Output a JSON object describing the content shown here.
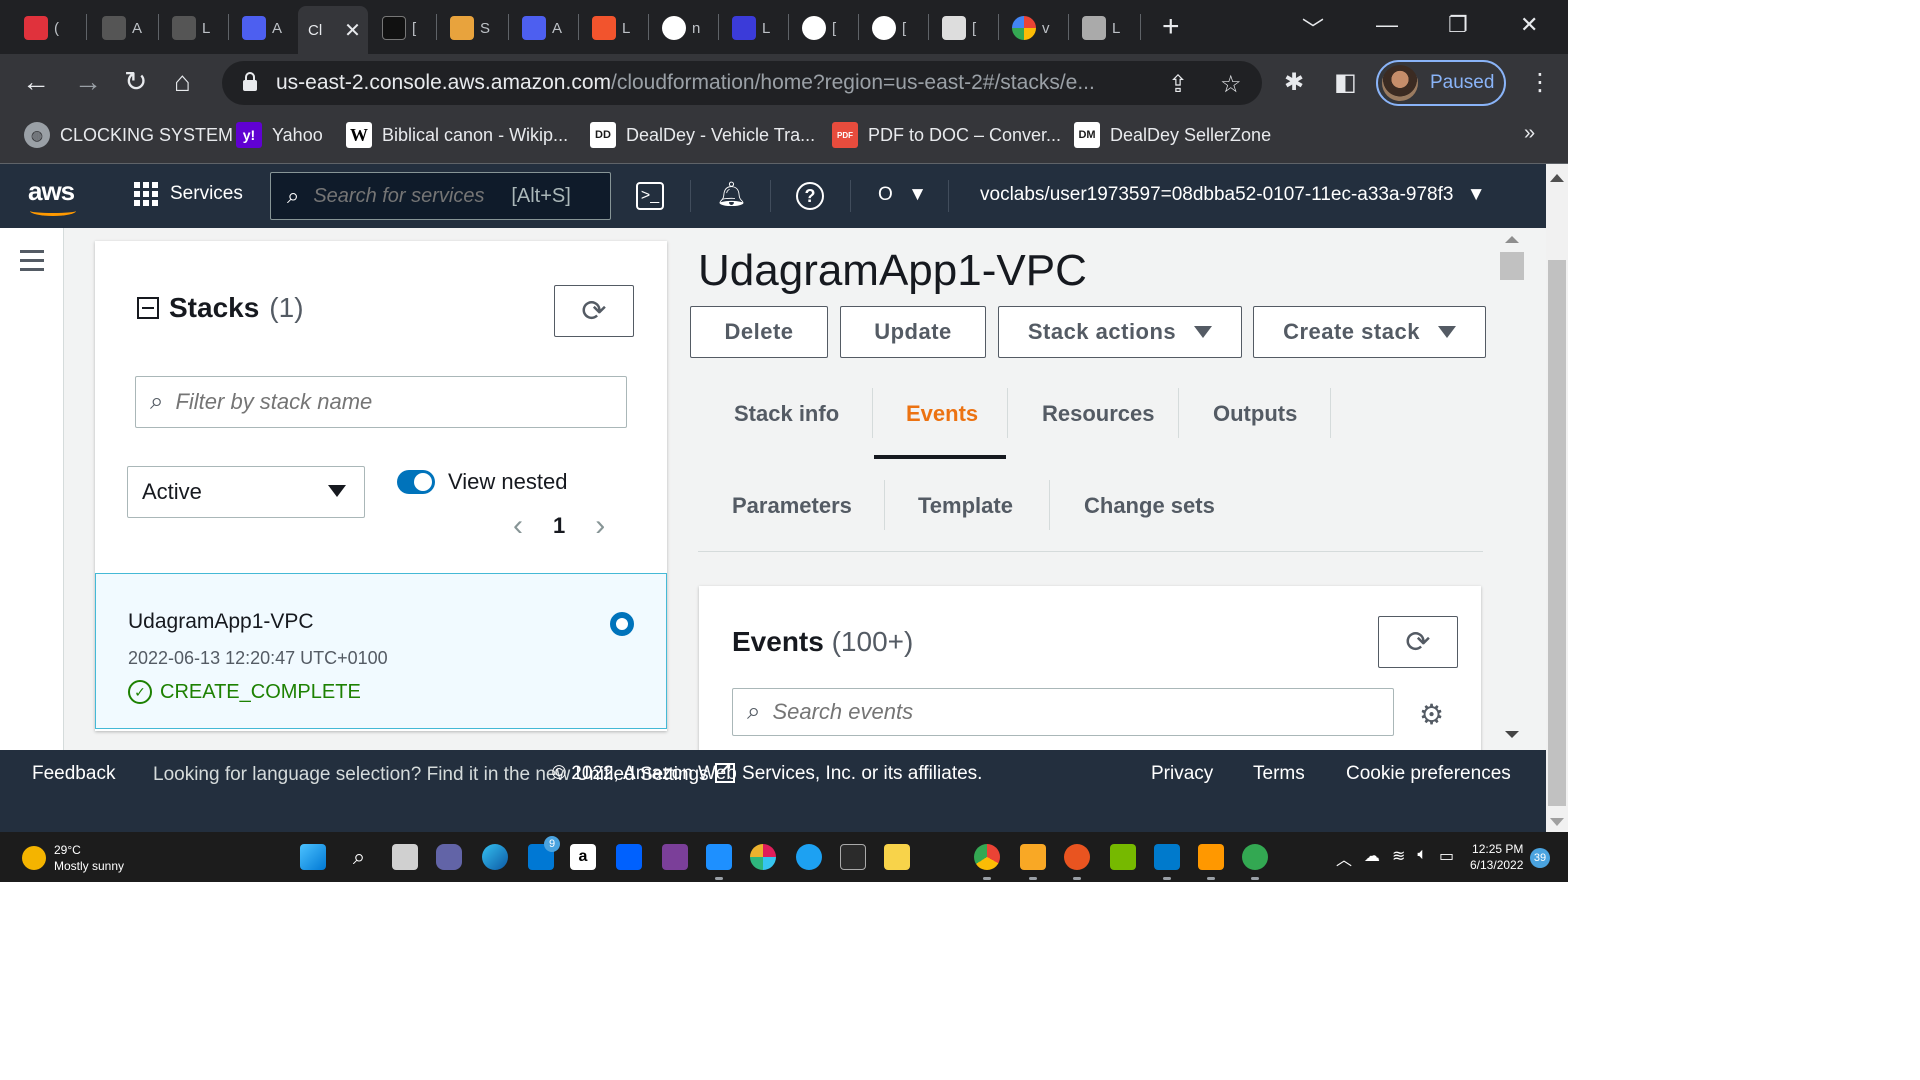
{
  "browser": {
    "tabs": [
      {
        "label": "(",
        "color": "#e0323c"
      },
      {
        "label": "A",
        "color": "#777777"
      },
      {
        "label": "L",
        "color": "#777777"
      },
      {
        "label": "A",
        "color": "#4d5ff0"
      },
      {
        "label": "Cl",
        "color": "#35363a",
        "active": true
      },
      {
        "label": "[",
        "color": "#111111"
      },
      {
        "label": "S",
        "color": "#e8a33d"
      },
      {
        "label": "A",
        "color": "#4d5ff0"
      },
      {
        "label": "L",
        "color": "#f2542d"
      },
      {
        "label": "n",
        "color": "#ffffff"
      },
      {
        "label": "L",
        "color": "#3b3bd9"
      },
      {
        "label": "[",
        "color": "#ffffff"
      },
      {
        "label": "[",
        "color": "#ffffff"
      },
      {
        "label": "[",
        "color": "#ffffff"
      },
      {
        "label": "v",
        "color": "#4285f4"
      },
      {
        "label": "L",
        "color": "#dddddd"
      }
    ],
    "url_host": "us-east-2.console.aws.amazon.com",
    "url_path": "/cloudformation/home?region=us-east-2#/stacks/e...",
    "profile_status": "Paused",
    "bookmarks": [
      {
        "label": "CLOCKING SYSTEM",
        "icon": "globe-icon",
        "badge": "",
        "color": "#9aa0a6"
      },
      {
        "label": "Yahoo",
        "icon": "yahoo-icon",
        "badge": "y!",
        "color": "#6001d2"
      },
      {
        "label": "Biblical canon - Wikip...",
        "icon": "wikipedia-icon",
        "badge": "W",
        "color": "#ffffff"
      },
      {
        "label": "DealDey - Vehicle Tra...",
        "icon": "dealdey-icon",
        "badge": "DD",
        "color": "#ffffff"
      },
      {
        "label": "PDF to DOC – Conver...",
        "icon": "pdf-doc-icon",
        "badge": "PDF",
        "color": "#e84c3d"
      },
      {
        "label": "DealDey SellerZone",
        "icon": "dealdey-seller-icon",
        "badge": "DM",
        "color": "#ffffff"
      }
    ],
    "bookmarks_more": "»"
  },
  "aws": {
    "logo": "aws",
    "services_label": "Services",
    "search_placeholder": "Search for services",
    "search_shortcut": "[Alt+S]",
    "region_label": "O",
    "account": "voclabs/user1973597=08dbba52-0107-11ec-a33a-978f3"
  },
  "stacks": {
    "title": "Stacks",
    "count": "(1)",
    "filter_placeholder": "Filter by stack name",
    "status_filter": "Active",
    "view_nested_label": "View nested",
    "page": "1",
    "items": [
      {
        "name": "UdagramApp1-VPC",
        "created": "2022-06-13 12:20:47 UTC+0100",
        "status": "CREATE_COMPLETE"
      }
    ]
  },
  "detail": {
    "title": "UdagramApp1-VPC",
    "buttons": {
      "delete": "Delete",
      "update": "Update",
      "stack_actions": "Stack actions",
      "create_stack": "Create stack"
    },
    "tabs": [
      "Stack info",
      "Events",
      "Resources",
      "Outputs",
      "Parameters",
      "Template",
      "Change sets"
    ],
    "active_tab": "Events",
    "events_title": "Events",
    "events_count": "(100+)",
    "events_search_placeholder": "Search events"
  },
  "footer": {
    "feedback": "Feedback",
    "language_text": "Looking for language selection? Find it in the new",
    "unified_settings": "Unified Settings",
    "privacy": "Privacy",
    "terms": "Terms",
    "cookie": "Cookie preferences",
    "copyright": "© 2022, Amazon Web Services, Inc. or its affiliates."
  },
  "taskbar": {
    "temperature": "29°C",
    "weather": "Mostly sunny",
    "time": "12:25 PM",
    "date": "6/13/2022",
    "notifications": "39",
    "mail_badge": "9"
  },
  "colors": {
    "accent": "#ec7211",
    "aws_nav": "#232f3e",
    "success": "#1d8102",
    "link": "#0073bb"
  }
}
